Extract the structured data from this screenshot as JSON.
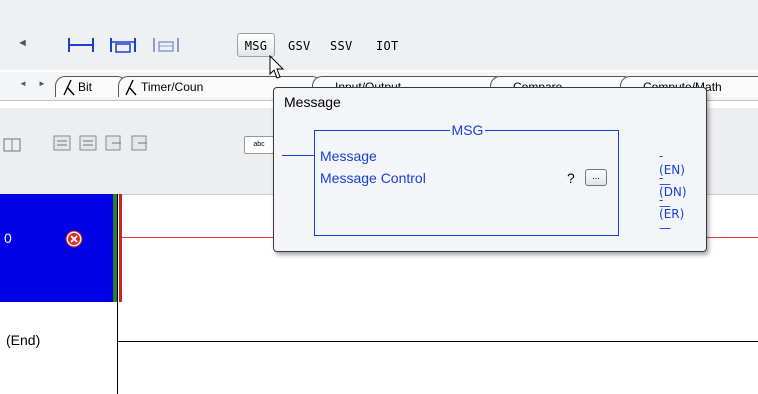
{
  "toolbar": {
    "nav_left": "◄",
    "instructions": [
      "MSG",
      "GSV",
      "SSV",
      "IOT"
    ]
  },
  "tabs": {
    "nav_left": "◄",
    "nav_right": "►",
    "items": [
      {
        "label": "Bit"
      },
      {
        "label": "Timer/Coun"
      },
      {
        "label": "Input/Output"
      },
      {
        "label": "Compare"
      },
      {
        "label": "Compute/Math"
      }
    ]
  },
  "tooltip": {
    "title": "Message",
    "block_name": "MSG",
    "rows": [
      "Message",
      "Message Control"
    ],
    "question_mark": "?",
    "browse_button": "...",
    "outputs": [
      "EN",
      "DN",
      "ER"
    ]
  },
  "ladder": {
    "rung_number": "0",
    "end_label": "(End)"
  },
  "colors": {
    "rung_header": "#0000e6",
    "block_accent": "#1a3fd6",
    "energized_line": "#e53935"
  }
}
